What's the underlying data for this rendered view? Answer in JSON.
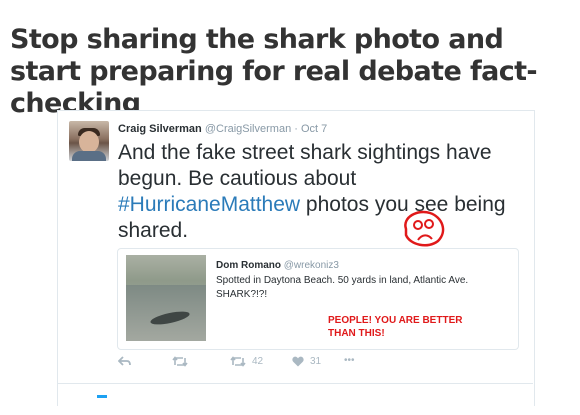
{
  "article": {
    "headline": "Stop sharing the shark photo and start preparing for real debate fact-checking"
  },
  "tweet": {
    "author_name": "Craig Silverman",
    "author_handle": "@CraigSilverman",
    "separator": "·",
    "date": "Oct 7",
    "text_before": "And the fake street shark sightings have begun. Be cautious about ",
    "hashtag": "#HurricaneMatthew",
    "text_after": " photos you see being shared.",
    "quoted": {
      "author_name": "Dom Romano",
      "author_handle": "@wrekoniz3",
      "text": "Spotted in Daytona Beach. 50 yards in land, Atlantic Ave. SHARK?!?!"
    },
    "actions": {
      "retweet_count": "42",
      "like_count": "31",
      "more": "•••"
    }
  },
  "annotation": {
    "text": "PEOPLE! YOU ARE BETTER THAN THIS!",
    "color": "#e0191a"
  },
  "colors": {
    "link": "#2b7bb9",
    "action_gray": "#aab8c2"
  }
}
